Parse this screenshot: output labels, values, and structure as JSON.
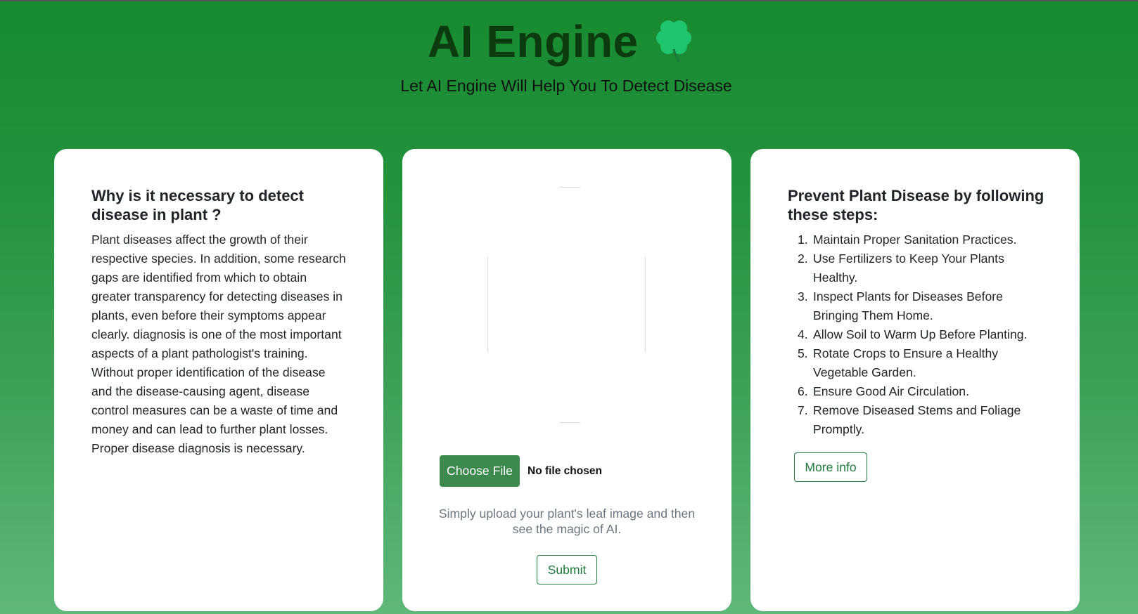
{
  "header": {
    "title": "AI Engine",
    "subtitle": "Let AI Engine Will Help You To Detect Disease",
    "logo_icon": "four-leaf-clover-icon"
  },
  "colors": {
    "background_top": "#178a2f",
    "background_bottom": "#5fb87a",
    "title": "#0d3b10",
    "accent": "#1e7b3c",
    "choose_button": "#3d8a4e",
    "clover": "#1fc46e"
  },
  "why_card": {
    "heading": "Why is it necessary to detect disease in plant ?",
    "body": "Plant diseases affect the growth of their respective species. In addition, some research gaps are identified from which to obtain greater transparency for detecting diseases in plants, even before their symptoms appear clearly. diagnosis is one of the most important aspects of a plant pathologist's training. Without proper identification of the disease and the disease-causing agent, disease control measures can be a waste of time and money and can lead to further plant losses. Proper disease diagnosis is necessary."
  },
  "upload_card": {
    "choose_file_label": "Choose File",
    "file_status": "No file chosen",
    "hint": "Simply upload your plant's leaf image and then see the magic of AI.",
    "submit_label": "Submit"
  },
  "prevent_card": {
    "heading": "Prevent Plant Disease by following these steps:",
    "steps": [
      {
        "num": "1.",
        "text": "Maintain Proper Sanitation Practices."
      },
      {
        "num": "2.",
        "text": "Use Fertilizers to Keep Your Plants Healthy."
      },
      {
        "num": "3.",
        "text": "Inspect Plants for Diseases Before Bringing Them Home."
      },
      {
        "num": "4.",
        "text": "Allow Soil to Warm Up Before Planting."
      },
      {
        "num": "5.",
        "text": "Rotate Crops to Ensure a Healthy Vegetable Garden."
      },
      {
        "num": "6.",
        "text": "Ensure Good Air Circulation."
      },
      {
        "num": "7.",
        "text": "Remove Diseased Stems and Foliage Promptly."
      }
    ],
    "more_info_label": "More info"
  }
}
